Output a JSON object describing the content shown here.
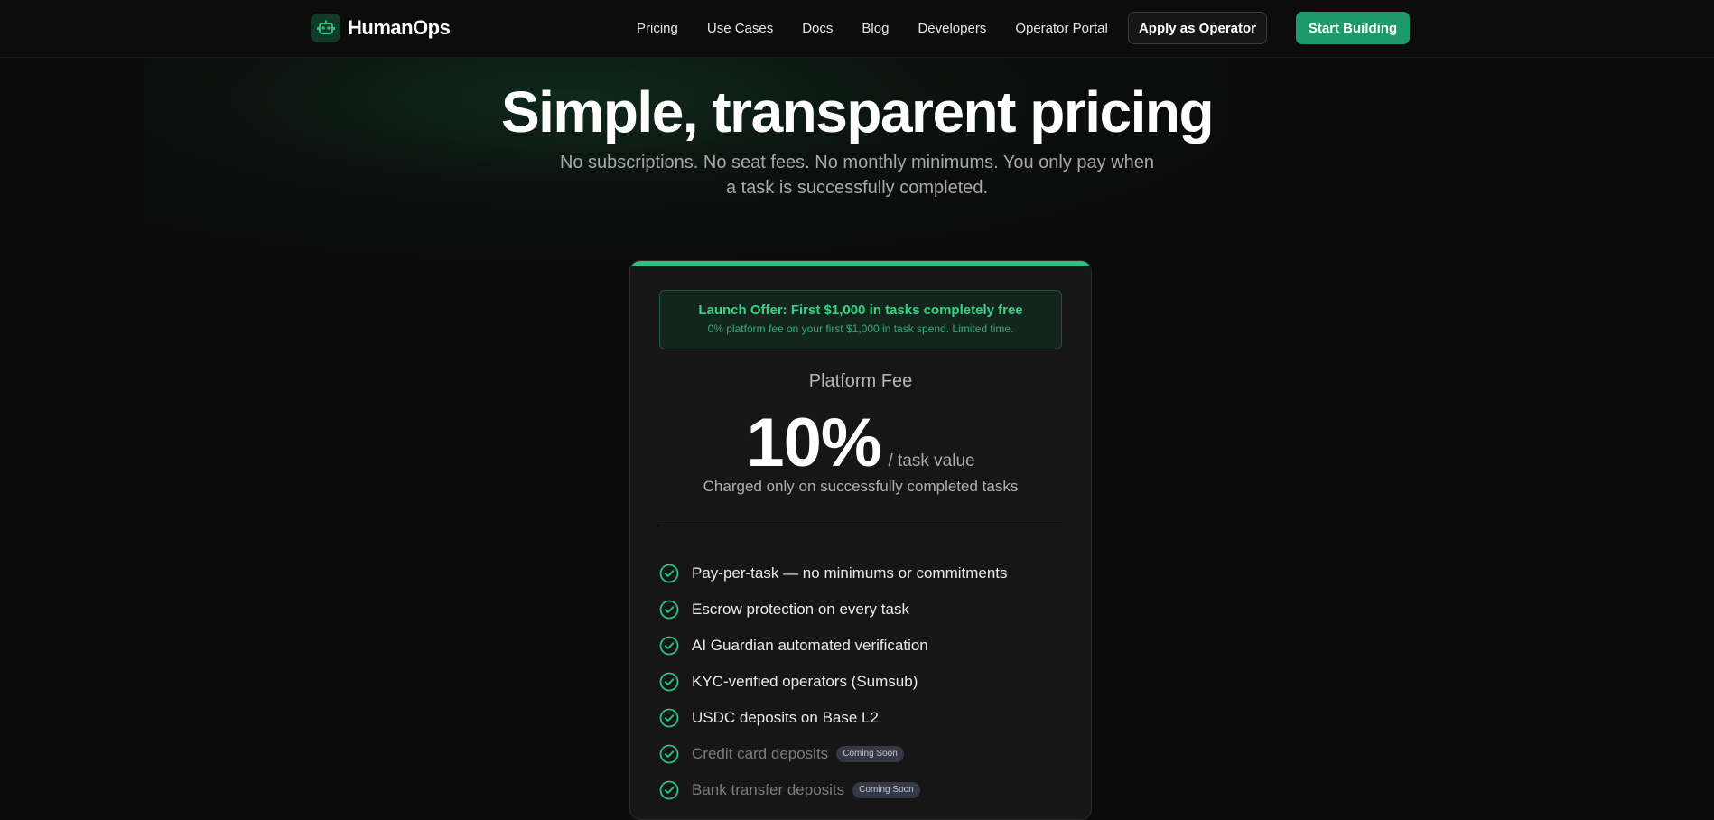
{
  "nav": {
    "brand": "HumanOps",
    "links": [
      "Pricing",
      "Use Cases",
      "Docs",
      "Blog",
      "Developers",
      "Operator Portal"
    ],
    "apply_label": "Apply as Operator",
    "start_label": "Start Building"
  },
  "hero": {
    "title": "Simple, transparent pricing",
    "subtitle_line1": "No subscriptions. No seat fees. No monthly minimums. You only pay when",
    "subtitle_line2": "a task is successfully completed."
  },
  "card": {
    "offer_title": "Launch Offer: First $1,000 in tasks completely free",
    "offer_subtitle": "0% platform fee on your first $1,000 in task spend. Limited time.",
    "fee_label": "Platform Fee",
    "price": "10%",
    "price_unit": "/ task value",
    "charged_note": "Charged only on successfully completed tasks",
    "features": [
      {
        "text": "Pay-per-task — no minimums or commitments",
        "badge": ""
      },
      {
        "text": "Escrow protection on every task",
        "badge": ""
      },
      {
        "text": "AI Guardian automated verification",
        "badge": ""
      },
      {
        "text": "KYC-verified operators (Sumsub)",
        "badge": ""
      },
      {
        "text": "USDC deposits on Base L2",
        "badge": ""
      },
      {
        "text": "Credit card deposits",
        "badge": "Coming Soon"
      },
      {
        "text": "Bank transfer deposits",
        "badge": "Coming Soon"
      }
    ]
  },
  "colors": {
    "accent": "#2fbf7f",
    "primary_button": "#1d9a6c",
    "background": "#0b0b0b",
    "card": "#161616"
  },
  "icons": [
    "robot-logo-icon",
    "check-circle-icon"
  ]
}
